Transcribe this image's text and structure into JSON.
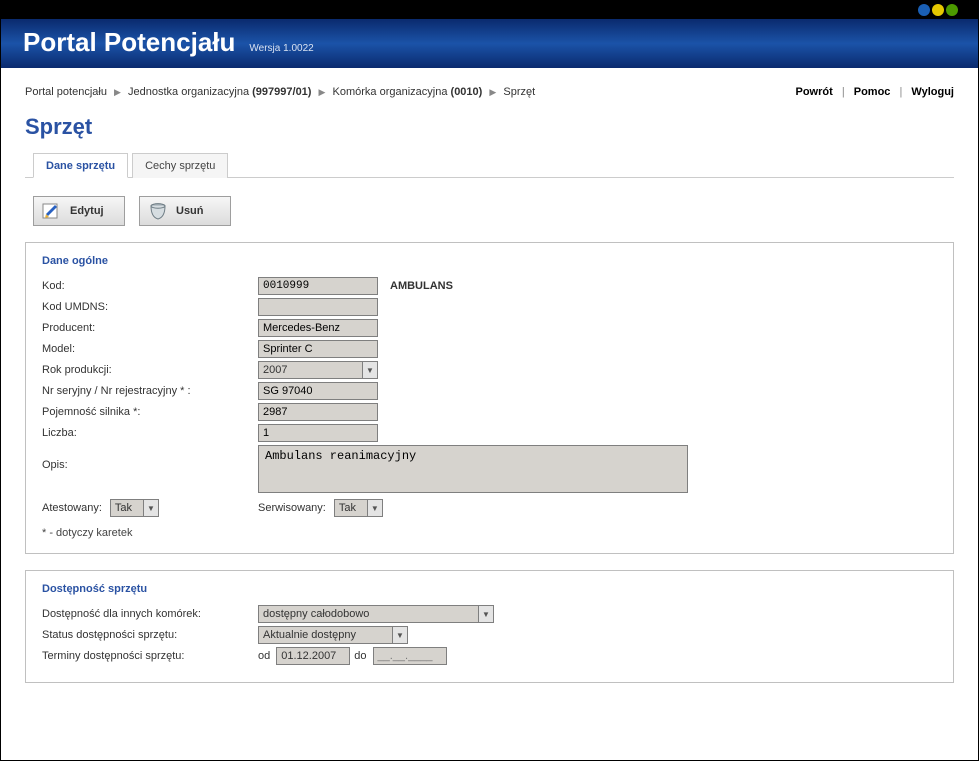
{
  "header": {
    "title": "Portal Potencjału",
    "version": "Wersja 1.0022"
  },
  "breadcrumb": {
    "root": "Portal potencjału",
    "unit_label": "Jednostka organizacyjna",
    "unit_code": "(997997/01)",
    "cell_label": "Komórka organizacyjna",
    "cell_code": "(0010)",
    "leaf": "Sprzęt"
  },
  "top_actions": {
    "back": "Powrót",
    "help": "Pomoc",
    "logout": "Wyloguj"
  },
  "page_title": "Sprzęt",
  "tabs": {
    "data": "Dane sprzętu",
    "features": "Cechy sprzętu"
  },
  "buttons": {
    "edit": "Edytuj",
    "delete": "Usuń"
  },
  "general": {
    "legend": "Dane ogólne",
    "labels": {
      "kod": "Kod:",
      "kod_umdns": "Kod UMDNS:",
      "producent": "Producent:",
      "model": "Model:",
      "rok": "Rok produkcji:",
      "nr_ser": "Nr seryjny / Nr rejestracyjny * :",
      "pojemnosc": "Pojemność silnika *:",
      "liczba": "Liczba:",
      "opis": "Opis:",
      "atestowany": "Atestowany:",
      "serwisowany": "Serwisowany:"
    },
    "values": {
      "kod": "0010999",
      "kod_side": "AMBULANS",
      "kod_umdns": "",
      "producent": "Mercedes-Benz",
      "model": "Sprinter C",
      "rok": "2007",
      "nr_ser": "SG 97040",
      "pojemnosc": "2987",
      "liczba": "1",
      "opis": "Ambulans reanimacyjny",
      "atestowany": "Tak",
      "serwisowany": "Tak"
    },
    "note": "* - dotyczy karetek"
  },
  "availability": {
    "legend": "Dostępność sprzętu",
    "labels": {
      "dla_innych": "Dostępność dla innych komórek:",
      "status": "Status dostępności sprzętu:",
      "terminy": "Terminy dostępności sprzętu:",
      "od": "od",
      "do": "do"
    },
    "values": {
      "dla_innych": "dostępny całodobowo",
      "status": "Aktualnie dostępny",
      "od": "01.12.2007",
      "do": "__.__.____"
    }
  }
}
